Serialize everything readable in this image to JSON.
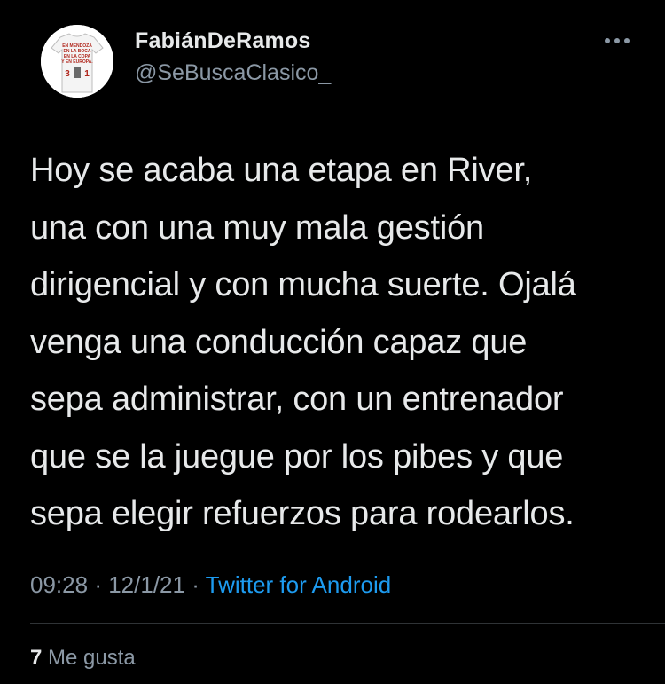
{
  "tweet": {
    "author": {
      "display_name": "FabiánDeRamos",
      "handle": "@SeBuscaClasico_",
      "avatar_text": [
        "EN MENDOZA",
        "EN LA BOCA",
        "EN LA COPA",
        "Y EN EUROPA.",
        "3",
        "1"
      ]
    },
    "text": "Hoy se acaba una etapa en River,\nuna con una muy mala gestión\ndirigencial y con mucha suerte. Ojalá\nvenga una conducción capaz que\nsepa administrar, con un entrenador\nque se la juegue por los pibes y que\nsepa elegir refuerzos para rodearlos.",
    "time": "09:28",
    "separator": "·",
    "date": "12/1/21",
    "source": "Twitter for Android",
    "likes_count": "7",
    "likes_label": "Me gusta"
  },
  "icons": {
    "more": "more-horizontal-icon"
  },
  "colors": {
    "background": "#000000",
    "primary_text": "#e7e9ea",
    "secondary_text": "#8b98a5",
    "link": "#1d9bf0",
    "divider": "#2f3336"
  }
}
